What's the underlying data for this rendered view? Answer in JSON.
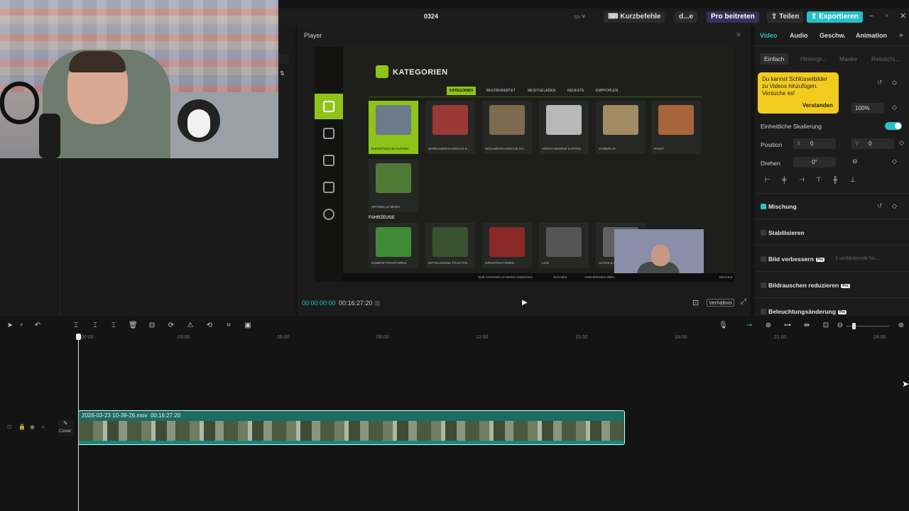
{
  "titlebar": {
    "project_name": "0324",
    "shortcuts_label": "Kurzbefehle",
    "user_label": "d...e",
    "pro_label": "Pro beitreten",
    "share_label": "Teilen",
    "export_label": "Exportieren"
  },
  "player": {
    "title": "Player",
    "current_time": "00:00:00:00",
    "total_time": "00:16:27:20",
    "ratio_label": "Verhältnis"
  },
  "game": {
    "heading": "KATEGORIEN",
    "tabs": [
      "KATEGORIEN",
      "BESTBEWERTET",
      "MEISTGELADEN",
      "NEUESTE",
      "EMPFOHLEN"
    ],
    "tiles": [
      "EUROPÄISCHE KARTEN",
      "NORDAMERIKANISCHE K...",
      "SÜDAMERIKANISCHE KA...",
      "VERSCHIEDENE KARTEN",
      "GAMEPLAY",
      "PAKET",
      "OFFIZIELLE MODS"
    ],
    "section2": "FAHRZEUGE",
    "tiles2": [
      "KOMPAKTTRAKTOREN",
      "MITTELGROSE TRAKTOR...",
      "GROSTRAKTOREN",
      "LKW",
      "AUTOS & M..."
    ],
    "bottom_items": [
      "NUR CROSSPLAY-MODS ANZEIGEN",
      "SUCHEN",
      "VORHERIGES MEN...",
      "DETAILS"
    ]
  },
  "properties": {
    "tabs": [
      "Video",
      "Audio",
      "Geschw.",
      "Animation"
    ],
    "subtabs": [
      "Einfach",
      "Hintergr...",
      "Maske",
      "Retuschi..."
    ],
    "tooltip_text": "Du kannst Schlüsselbilder zu Videos hinzufügen. Versuche es!",
    "tooltip_button": "Verstanden",
    "scale_value": "100%",
    "uniform_scale_label": "Einheitliche Skalierung",
    "position_label": "Position",
    "pos_x_label": "X",
    "pos_x": "0",
    "pos_y_label": "Y",
    "pos_y": "0",
    "rotate_label": "Drehen",
    "rotate_value": "0°",
    "blend_label": "Mischung",
    "stabilize_label": "Stabilisieren",
    "enhance_label": "Bild verbessern",
    "enhance_note": "3 verbleibende Nu...",
    "denoise_label": "Bildrauschen reduzieren",
    "lighting_label": "Beleuchtungsänderung",
    "pro_badge": "Pro"
  },
  "timeline": {
    "ticks": [
      "00:00",
      "03:00",
      "06:00",
      "09:00",
      "12:00",
      "15:00",
      "18:00",
      "21:00",
      "24:00"
    ],
    "clip_name": "2026-03-23 10-39-26.mov",
    "clip_duration": "00:16:27:20",
    "cover_label": "Cover"
  },
  "colors": {
    "accent": "#27c0c6",
    "game_green": "#8ec417",
    "tooltip_yellow": "#f2cb1f",
    "clip_teal": "#1d6b63"
  }
}
